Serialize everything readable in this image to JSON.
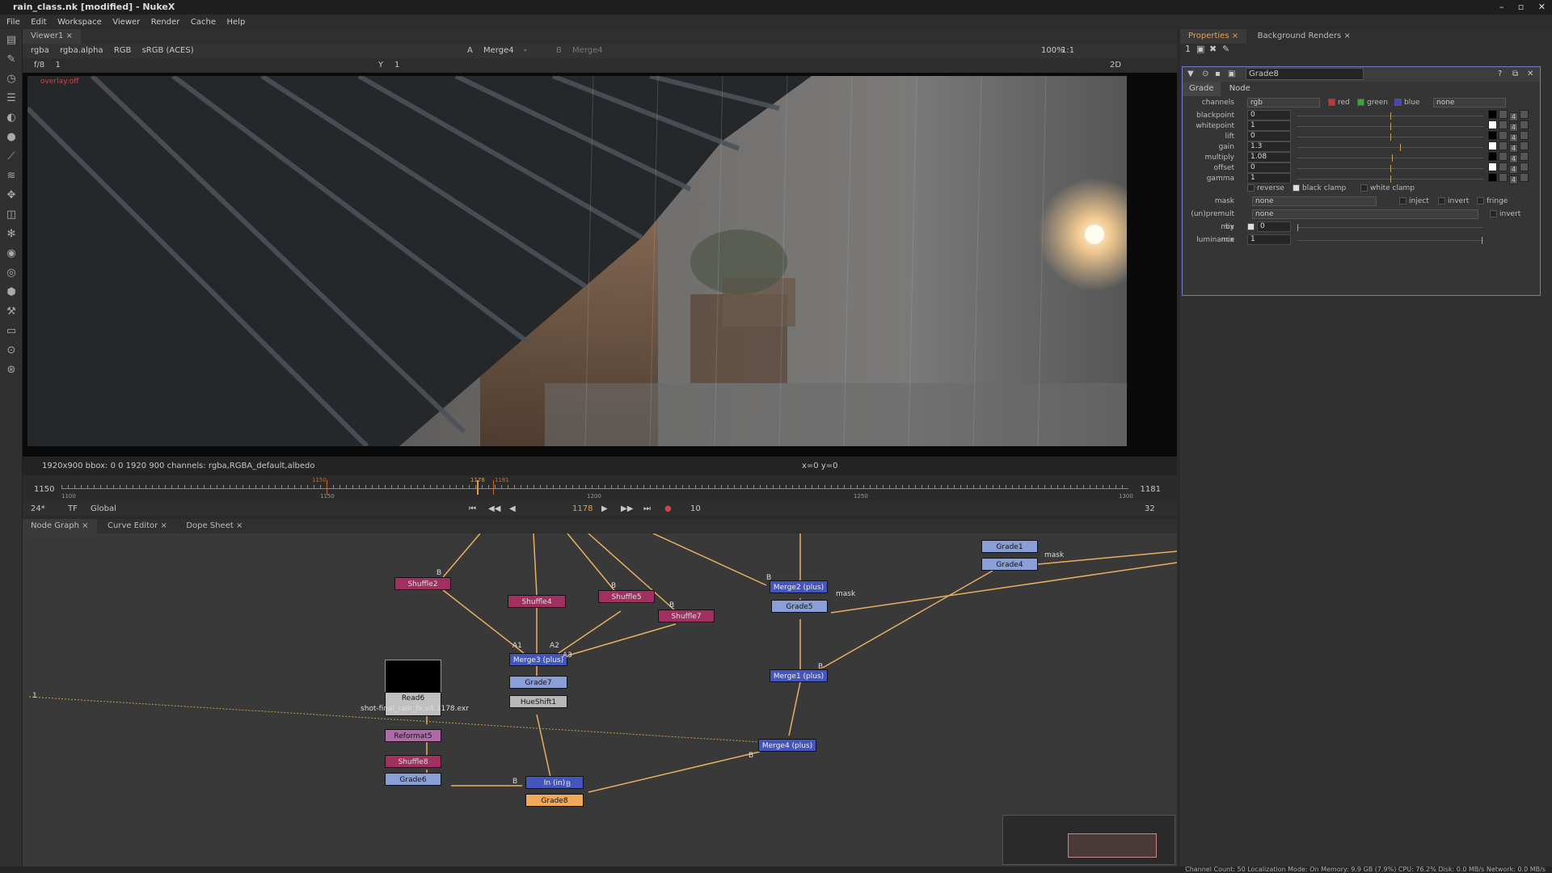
{
  "window": {
    "title": "rain_class.nk [modified] - NukeX",
    "controls": [
      "–",
      "▫",
      "✕"
    ]
  },
  "menu": [
    "File",
    "Edit",
    "Workspace",
    "Viewer",
    "Render",
    "Cache",
    "Help"
  ],
  "viewer": {
    "tab": "Viewer1",
    "channels": "rgba",
    "alpha": "rgba.alpha",
    "colorspace_mode": "RGB",
    "display": "sRGB (ACES)",
    "input_a": "Merge4",
    "input_dash": "-",
    "input_b": "Merge4",
    "zoom": "100%",
    "ratio": "1:1",
    "fstop": "f/8",
    "frame_field": "1",
    "y_label": "Y",
    "y_value": "1",
    "view_mode": "2D",
    "overlay_tag": "overlay:off",
    "info_left": "1920x900  bbox: 0 0 1920 900 channels: rgba,RGBA_default,albedo",
    "info_center": "x=0 y=0"
  },
  "timeline": {
    "start": "1150",
    "end": "1181",
    "tick_1100": "1100",
    "tick_1150": "1150",
    "tick_1200": "1200",
    "tick_1250": "1250",
    "tick_1300": "1300",
    "current": "1178",
    "in_marker": "1150",
    "out_marker": "1181"
  },
  "playback": {
    "fps": "24*",
    "tf": "TF",
    "scope": "Global",
    "frame": "1178",
    "step": "10",
    "fps_right": "32"
  },
  "bottom_tabs": [
    "Node Graph",
    "Curve Editor",
    "Dope Sheet"
  ],
  "nodes": {
    "shuffle2": "Shuffle2",
    "shuffle4": "Shuffle4",
    "shuffle5": "Shuffle5",
    "shuffle7": "Shuffle7",
    "merge3": "Merge3 (plus)",
    "grade7": "Grade7",
    "hueshift1": "HueShift1",
    "read6": "Read6",
    "read6_file": "shot-final_rain_fx.v4.1178.exr",
    "reformat5": "Reformat5",
    "shuffle8": "Shuffle8",
    "grade6": "Grade6",
    "in": "In (in)",
    "grade8": "Grade8",
    "merge2": "Merge2 (plus)",
    "grade5": "Grade5",
    "merge1": "Merge1 (plus)",
    "merge4": "Merge4 (plus)",
    "grade1": "Grade1",
    "grade4": "Grade4"
  },
  "edge_labels": {
    "mask1": "mask",
    "mask2": "mask",
    "a1": "A1",
    "a2": "A2",
    "a3": "A3",
    "b1": "B",
    "b2": "B",
    "b3": "B",
    "b4": "B",
    "b5": "B",
    "b6": "B",
    "b7": "B",
    "b8": "B",
    "one": "1"
  },
  "properties": {
    "tabs": [
      "Properties",
      "Background Renders"
    ],
    "node_name": "Grade8",
    "panel_tabs": [
      "Grade",
      "Node"
    ],
    "channels_label": "channels",
    "channels_value": "rgb",
    "ch_red": "red",
    "ch_green": "green",
    "ch_blue": "blue",
    "ch_extra": "none",
    "params": [
      {
        "label": "blackpoint",
        "value": "0"
      },
      {
        "label": "whitepoint",
        "value": "1"
      },
      {
        "label": "lift",
        "value": "0"
      },
      {
        "label": "gain",
        "value": "1.3"
      },
      {
        "label": "multiply",
        "value": "1.08"
      },
      {
        "label": "offset",
        "value": "0"
      },
      {
        "label": "gamma",
        "value": "1"
      }
    ],
    "param_btn_num": "4",
    "reverse": "reverse",
    "black_clamp": "black clamp",
    "white_clamp": "white clamp",
    "mask_label": "mask",
    "mask_value": "none",
    "inject": "inject",
    "invert": "invert",
    "fringe": "fringe",
    "unpremult_label": "(un)premult by",
    "unpremult_value": "none",
    "unpremult_invert": "invert",
    "mix_luminance_label": "mix luminance",
    "mix_luminance_value": "0",
    "mix_label": "mix",
    "mix_value": "1"
  },
  "status": "Channel Count: 50  Localization Mode: On  Memory: 9.9 GB (7.9%) CPU: 76.2% Disk: 0.0 MB/s Network: 0.0 MB/s"
}
